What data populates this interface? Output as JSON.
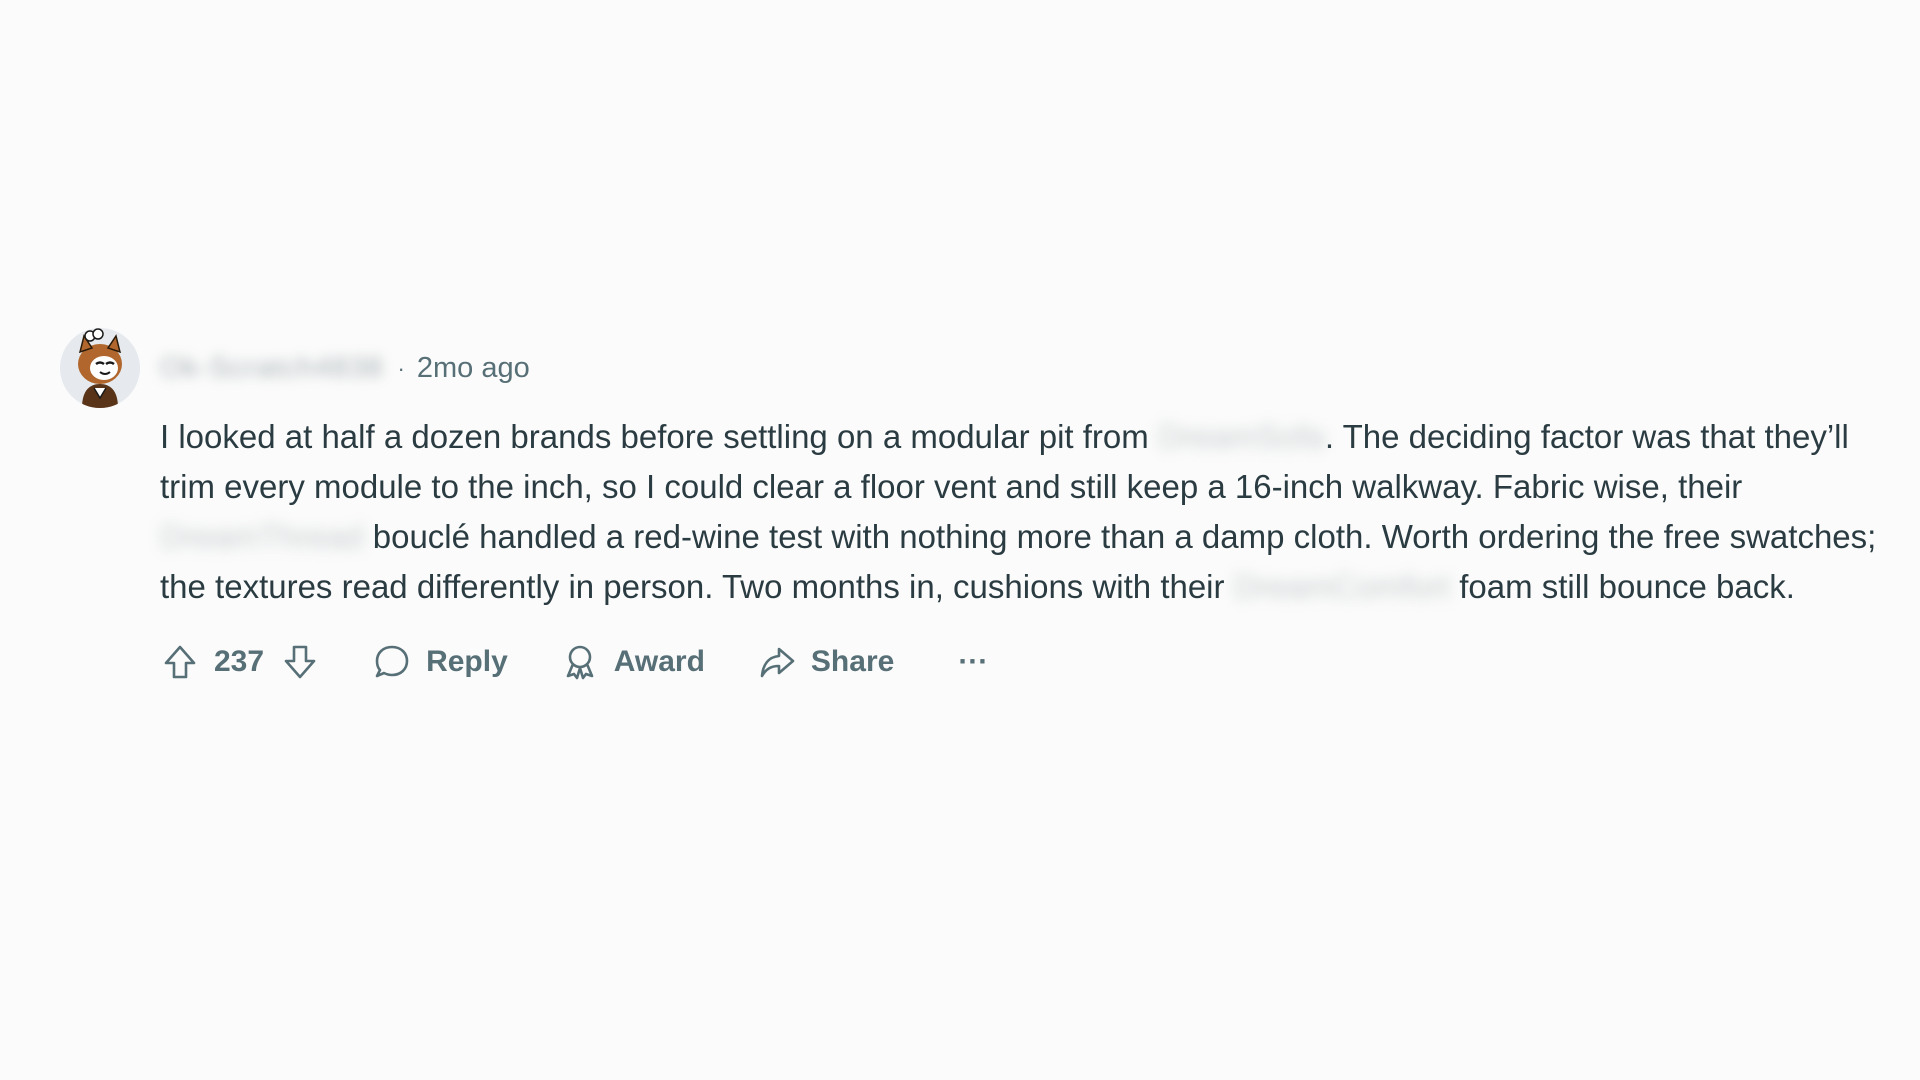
{
  "comment": {
    "author": {
      "username": "Ok-Scratch4838",
      "avatar_icon": "cartoon-cat-avatar"
    },
    "separator": "·",
    "timestamp": "2mo ago",
    "body": {
      "segment_1": "I looked at half a dozen brands before settling on a modular pit from ",
      "redacted_1": "DreamSofa",
      "segment_2": ". The deciding factor was that they’ll trim every module to the inch, so I could clear a floor vent and still keep a 16-inch walkway. Fabric wise, their ",
      "redacted_2": "DreamThread",
      "segment_3": " bouclé handled a red-wine test with nothing more than a damp cloth. Worth ordering the free swatches; the textures read differently in person. Two months in, cushions with their ",
      "redacted_3": "DreamComfort",
      "segment_4": " foam still bounce back."
    },
    "actions": {
      "upvote_icon": "arrow-up-icon",
      "vote_count": "237",
      "downvote_icon": "arrow-down-icon",
      "reply_label": "Reply",
      "reply_icon": "speech-bubble-icon",
      "award_label": "Award",
      "award_icon": "award-ribbon-icon",
      "share_label": "Share",
      "share_icon": "share-arrow-icon",
      "more_label": "···"
    }
  },
  "colors": {
    "background": "#fbfbfb",
    "body_text": "#2a3c42",
    "meta_text": "#576f76"
  }
}
